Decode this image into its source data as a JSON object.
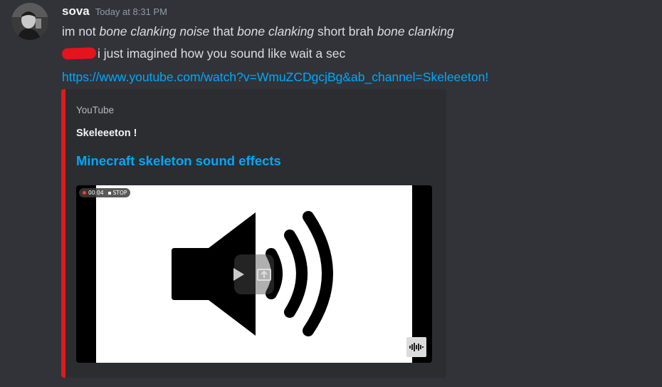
{
  "message": {
    "username": "sova",
    "timestamp": "Today at 8:31 PM",
    "line1": {
      "p1": "im not ",
      "i1": "bone clanking noise",
      "p2": " that ",
      "i2": "bone clanking",
      "p3": " short brah ",
      "i3": "bone clanking"
    },
    "line2": "i just imagined how you sound like wait a sec",
    "link": "https://www.youtube.com/watch?v=WmuZCDgcjBg&ab_channel=Skeleeeton!"
  },
  "embed": {
    "provider": "YouTube",
    "author": "Skeleeeton !",
    "title": "Minecraft skeleton sound effects",
    "accent_color": "#e11919",
    "video": {
      "rec_time": "00:04",
      "stop_label": "STOP",
      "thumbnail_icon": "speaker-volume-icon"
    }
  }
}
